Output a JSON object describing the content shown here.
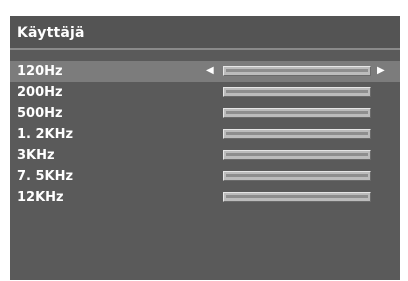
{
  "menu": {
    "title": "Käyttäjä",
    "arrows": {
      "left": "◀",
      "right": "▶"
    },
    "selected_index": 0,
    "bands": [
      {
        "label": "120Hz",
        "level": 0.5
      },
      {
        "label": "200Hz",
        "level": 0.5
      },
      {
        "label": "500Hz",
        "level": 0.5
      },
      {
        "label": "1. 2KHz",
        "level": 0.5
      },
      {
        "label": "3KHz",
        "level": 0.5
      },
      {
        "label": "7. 5KHz",
        "level": 0.5
      },
      {
        "label": "12KHz",
        "level": 0.5
      }
    ]
  }
}
